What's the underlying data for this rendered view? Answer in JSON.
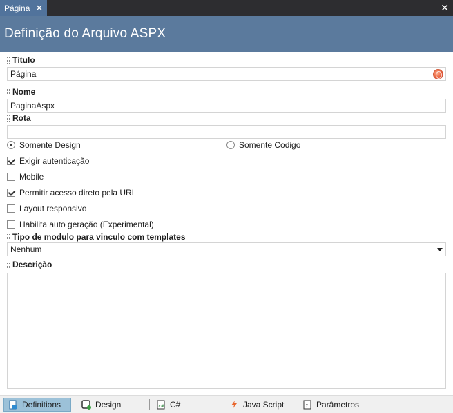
{
  "tab": {
    "label": "Página"
  },
  "header": {
    "title": "Definição do Arquivo ASPX"
  },
  "fields": {
    "titulo": {
      "label": "Título",
      "value": "Página"
    },
    "nome": {
      "label": "Nome",
      "value": "PaginaAspx"
    },
    "rota": {
      "label": "Rota",
      "value": ""
    }
  },
  "radios": [
    {
      "label": "Somente Design",
      "checked": true
    },
    {
      "label": "Somente Codigo",
      "checked": false
    }
  ],
  "checkboxes": [
    {
      "label": "Exigir autenticação",
      "checked": true
    },
    {
      "label": "Mobile",
      "checked": false
    },
    {
      "label": "Permitir acesso direto pela URL",
      "checked": true
    },
    {
      "label": "Layout responsivo",
      "checked": false
    },
    {
      "label": "Habilita auto geração (Experimental)",
      "checked": false
    }
  ],
  "module_type": {
    "label": "Tipo de modulo para vinculo com templates",
    "selected": "Nenhum"
  },
  "descricao": {
    "label": "Descrição",
    "value": ""
  },
  "bottom_tabs": [
    {
      "label": "Definitions",
      "icon": "definitions-icon",
      "active": true
    },
    {
      "label": "Design",
      "icon": "design-icon",
      "active": false
    },
    {
      "label": "C#",
      "icon": "csharp-file-icon",
      "active": false
    },
    {
      "label": "Java Script",
      "icon": "javascript-icon",
      "active": false
    },
    {
      "label": "Parâmetros",
      "icon": "parameters-icon",
      "active": false
    }
  ],
  "colors": {
    "header_bg": "#5b7a9d",
    "tab_bg": "#51739c",
    "tabstrip_bg": "#2d2d30",
    "active_bottom_tab": "#9cc1d8"
  }
}
